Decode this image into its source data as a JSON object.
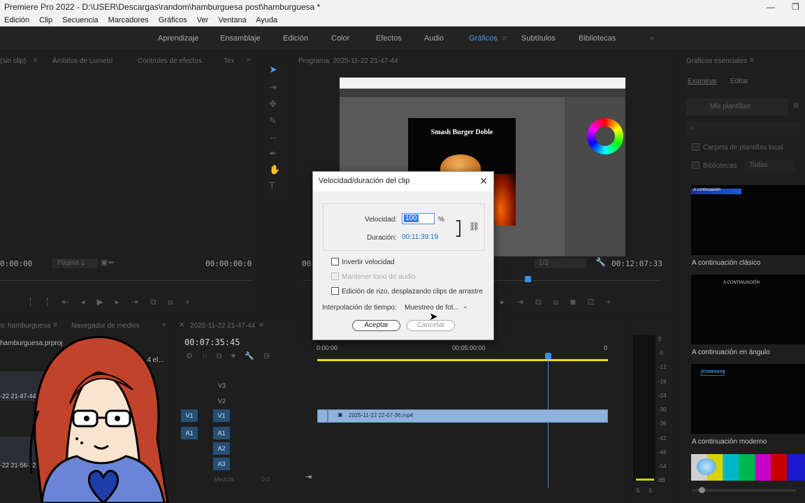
{
  "window": {
    "title": "Premiere Pro 2022 - D:\\USER\\Descargas\\random\\hamburguesa post\\hamburguesa *"
  },
  "menu": [
    "Edición",
    "Clip",
    "Secuencia",
    "Marcadores",
    "Gráficos",
    "Ver",
    "Ventana",
    "Ayuda"
  ],
  "workspaces": [
    "Aprendizaje",
    "Ensamblaje",
    "Edición",
    "Color",
    "Efectos",
    "Audio",
    "Gráficos",
    "Subtítulos",
    "Bibliotecas"
  ],
  "active_workspace": "Gráficos",
  "source_panel": {
    "tabs": [
      "(sin clip)",
      "Ámbitos de Lumetri",
      "Controles de efectos",
      "Tex"
    ],
    "timecode_left": "0:00:00",
    "zoom": "Página 1",
    "timecode_right": "00:00:00:0"
  },
  "program_panel": {
    "title": "Programa: 2025-11-22 21-47-44",
    "timecode_left": "00",
    "fit": "1/2",
    "timecode_right": "00:12:07:33",
    "frame_title": "Smash Burger Doble"
  },
  "essential_graphics": {
    "title": "Gráficos esenciales",
    "tabs": [
      "Examinar",
      "Editar"
    ],
    "my_templates": "Mis plantillas",
    "local_templates_folder": "Carpeta de plantillas local",
    "libraries": "Bibliotecas",
    "libraries_filter": "Todas",
    "templates": [
      {
        "name": "A continuación clásico",
        "preview_text": "A continuación"
      },
      {
        "name": "A continuación en ángulo",
        "preview_text": "A CONTINUACIÓN"
      },
      {
        "name": "A continuación moderno",
        "preview_text": "A continuación"
      }
    ]
  },
  "project_panel": {
    "tabs": [
      "o: hamburguesa",
      "Navegador de medios"
    ],
    "file": "hamburguesa.prproj",
    "count_text": "e 4 el...",
    "items": [
      "-22 21-47-44...",
      "-22 21-56-32..."
    ]
  },
  "timeline": {
    "tab": "2025-11-22 21-47-44",
    "timecode": "00:07:35:45",
    "ruler": [
      "0:00:00",
      "00:05:00:00",
      "0"
    ],
    "video_tracks": [
      "V3",
      "V2",
      "V1"
    ],
    "audio_tracks": [
      "A1",
      "A2",
      "A3"
    ],
    "source_v": "V1",
    "source_a": "A1",
    "mix_label": "Mezcla",
    "mix_value": "0.0",
    "clip_name": "2025-11-22 22-07-36.mp4"
  },
  "audio_meter": {
    "scale": [
      "0",
      "-6",
      "-12",
      "-18",
      "-24",
      "-30",
      "-36",
      "-42",
      "-48",
      "-54",
      "dB"
    ],
    "solo": [
      "S",
      "S"
    ]
  },
  "dialog": {
    "title": "Velocidad/duración del clip",
    "speed_label": "Velocidad:",
    "speed_value": "100",
    "speed_unit": "%",
    "duration_label": "Duración:",
    "duration_value": "00:11:39:19",
    "reverse_speed": "Invertir velocidad",
    "maintain_pitch": "Mantener tono de audio",
    "ripple_edit": "Edición de rizo, desplazando clips de arrastre",
    "time_interp_label": "Interpolación de tiempo:",
    "time_interp_value": "Muestreo de fot...",
    "ok": "Aceptar",
    "cancel": "Cancelar"
  },
  "colors": {
    "accent": "#4d9cf2",
    "clip": "#8fb2dc",
    "track_badge": "#264f73",
    "playhead": "#3a8ee6"
  }
}
